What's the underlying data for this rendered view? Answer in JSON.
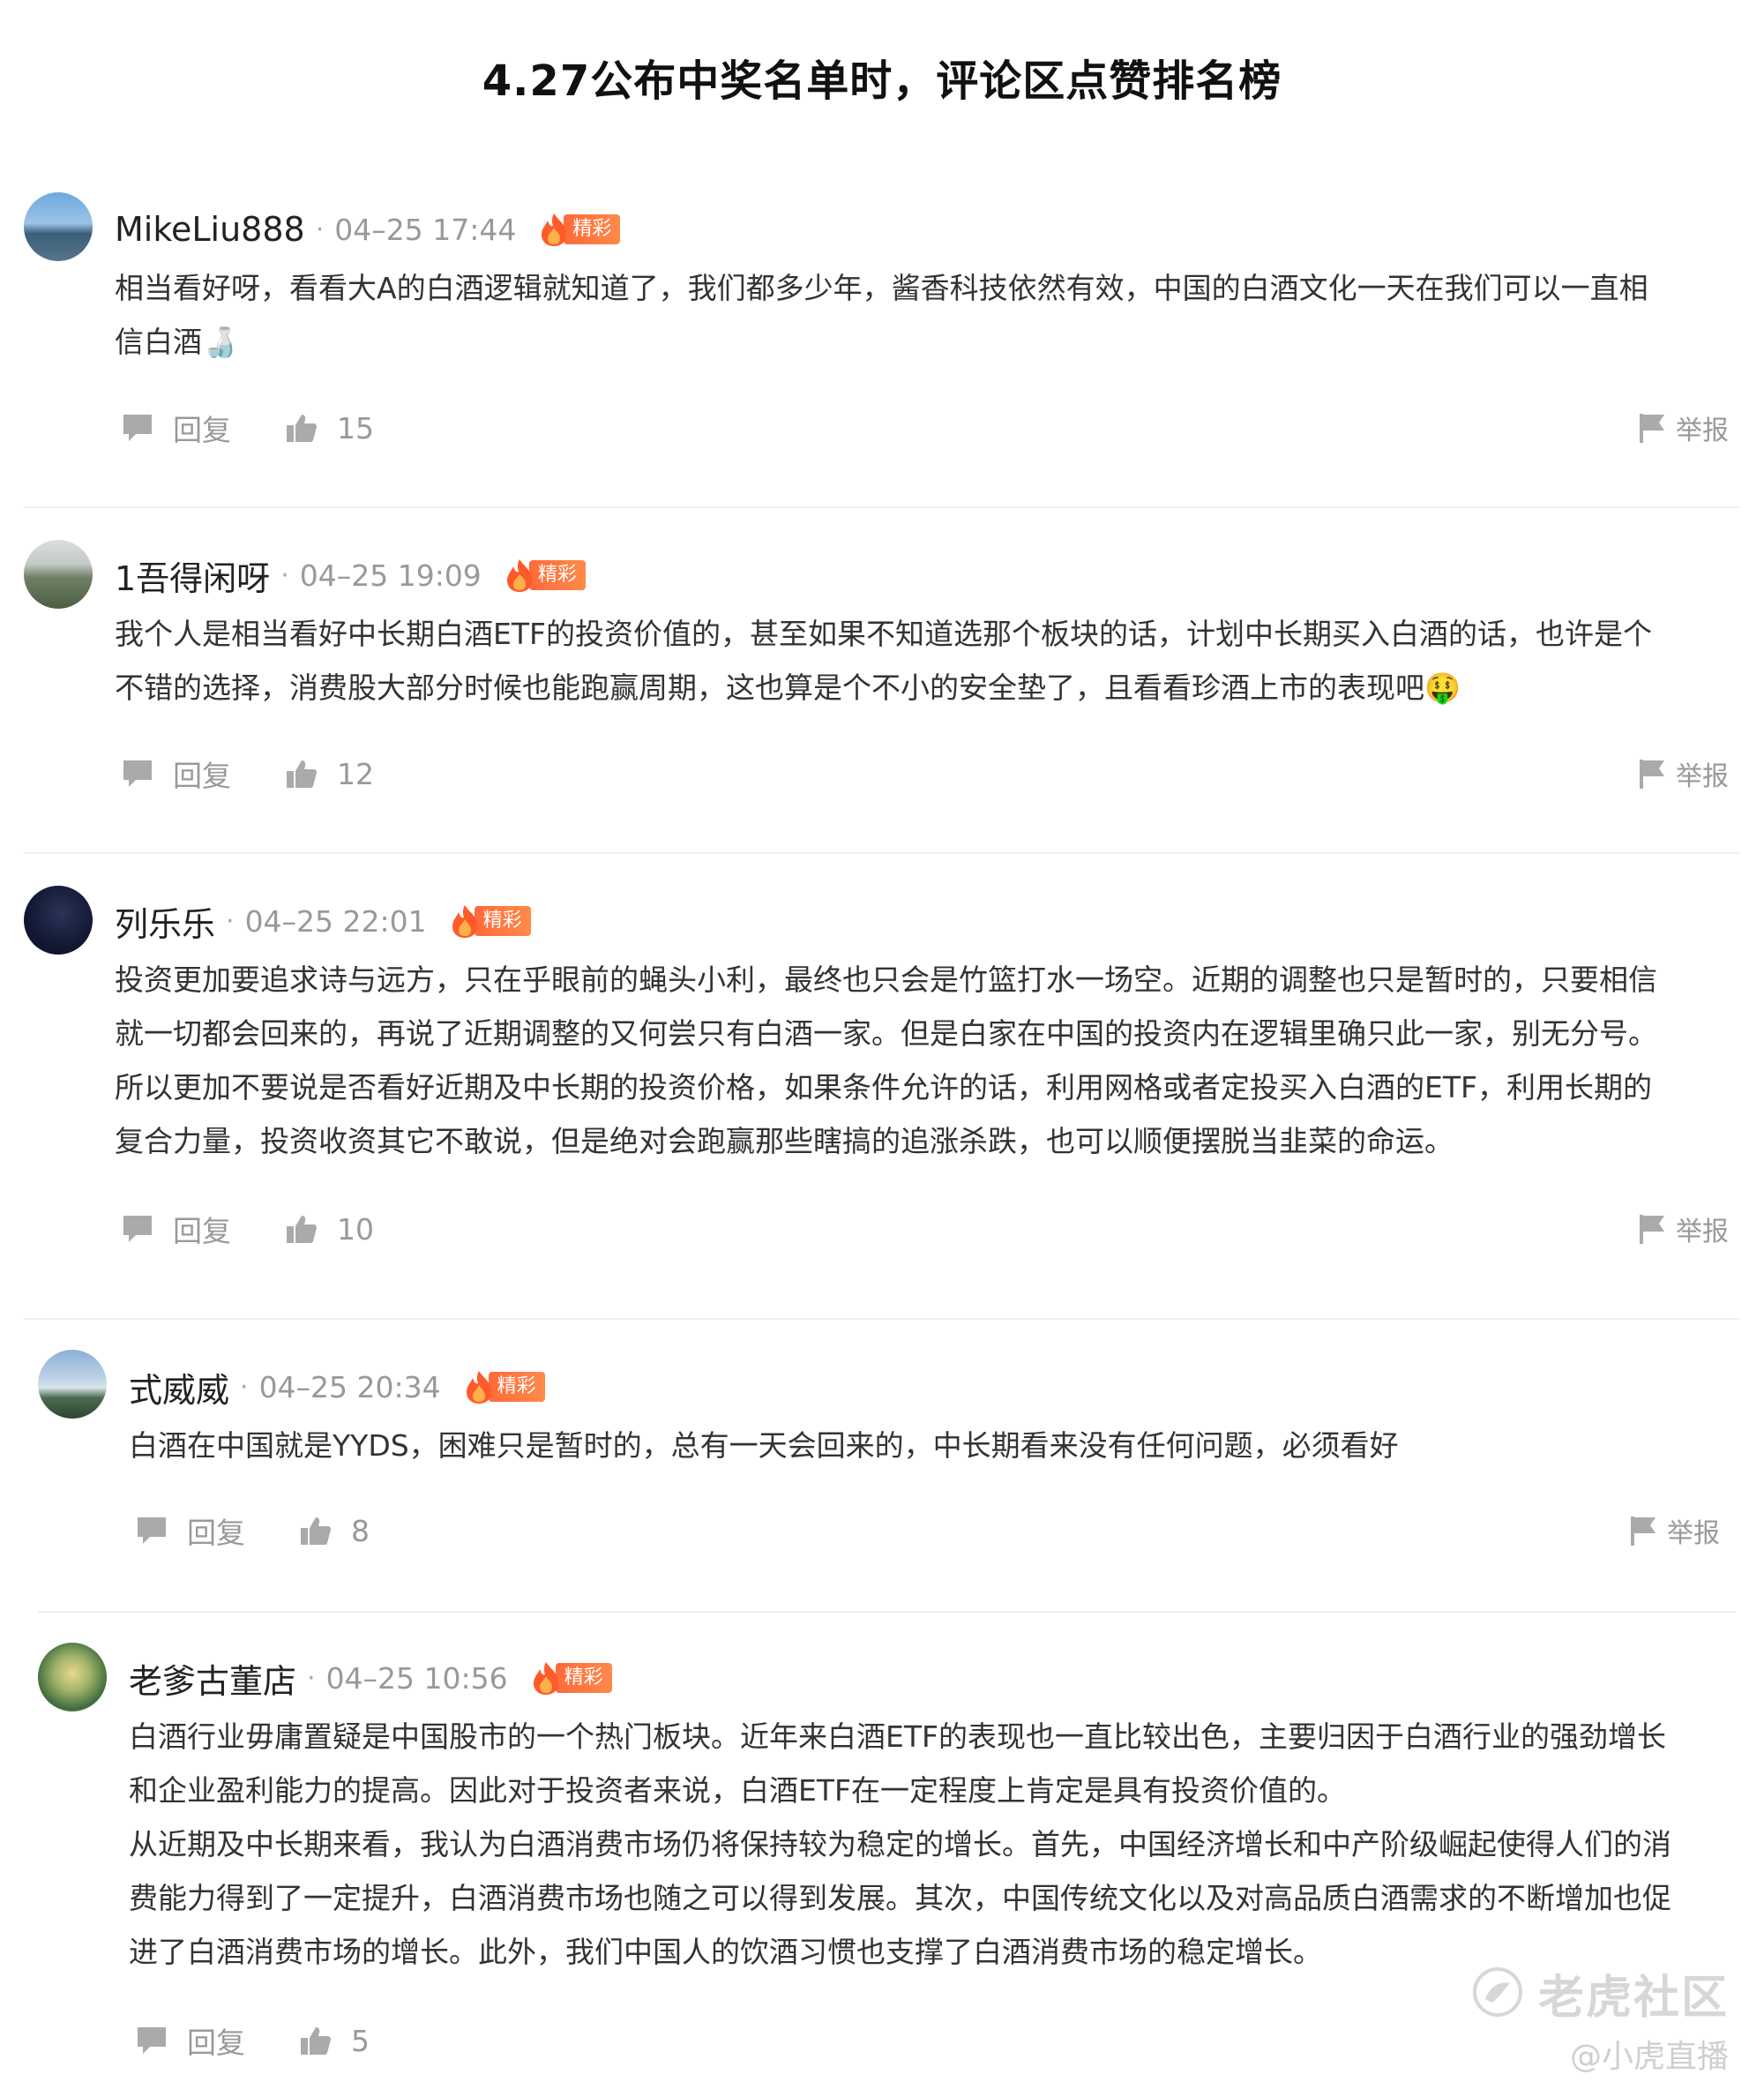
{
  "page": {
    "title": "4.27公布中奖名单时，评论区点赞排名榜"
  },
  "labels": {
    "reply": "回复",
    "report": "举报",
    "badge": "精彩"
  },
  "comments": [
    {
      "user": "MikeLiu888",
      "time": "04–25 17:44",
      "lines": [
        "相当看好呀，看看大A的白酒逻辑就知道了，我们都多少年，酱香科技依然有效，中国的白酒文化一天在我们可以一直相",
        "信白酒🍶"
      ],
      "likes": "15"
    },
    {
      "user": "1吾得闲呀",
      "time": "04–25 19:09",
      "lines": [
        "我个人是相当看好中长期白酒ETF的投资价值的，甚至如果不知道选那个板块的话，计划中长期买入白酒的话，也许是个",
        "不错的选择，消费股大部分时候也能跑赢周期，这也算是个不小的安全垫了，且看看珍酒上市的表现吧🤑"
      ],
      "likes": "12"
    },
    {
      "user": "列乐乐",
      "time": "04–25 22:01",
      "lines": [
        "投资更加要追求诗与远方，只在乎眼前的蝇头小利，最终也只会是竹篮打水一场空。近期的调整也只是暂时的，只要相信",
        "就一切都会回来的，再说了近期调整的又何尝只有白酒一家。但是白家在中国的投资内在逻辑里确只此一家，别无分号。",
        "所以更加不要说是否看好近期及中长期的投资价格，如果条件允许的话，利用网格或者定投买入白酒的ETF，利用长期的",
        "复合力量，投资收资其它不敢说，但是绝对会跑赢那些瞎搞的追涨杀跌，也可以顺便摆脱当韭菜的命运。"
      ],
      "likes": "10"
    },
    {
      "user": "式威威",
      "time": "04–25 20:34",
      "lines": [
        "白酒在中国就是YYDS，困难只是暂时的，总有一天会回来的，中长期看来没有任何问题，必须看好"
      ],
      "likes": "8"
    },
    {
      "user": "老爹古董店",
      "time": "04–25 10:56",
      "lines": [
        "白酒行业毋庸置疑是中国股市的一个热门板块。近年来白酒ETF的表现也一直比较出色，主要归因于白酒行业的强劲增长",
        "和企业盈利能力的提高。因此对于投资者来说，白酒ETF在一定程度上肯定是具有投资价值的。",
        "从近期及中长期来看，我认为白酒消费市场仍将保持较为稳定的增长。首先，中国经济增长和中产阶级崛起使得人们的消",
        "费能力得到了一定提升，白酒消费市场也随之可以得到发展。其次，中国传统文化以及对高品质白酒需求的不断增加也促",
        "进了白酒消费市场的增长。此外，我们中国人的饮酒习惯也支撑了白酒消费市场的稳定增长。"
      ],
      "likes": "5"
    }
  ],
  "watermark": {
    "brand": "老虎社区",
    "sub": "@小虎直播"
  },
  "icons": [
    "reply-icon",
    "thumbs-up-icon",
    "flag-icon",
    "flame-icon",
    "tiger-logo-icon"
  ],
  "colors": {
    "badge": "#ff6a3a",
    "muted": "#999999",
    "text": "#333333"
  }
}
